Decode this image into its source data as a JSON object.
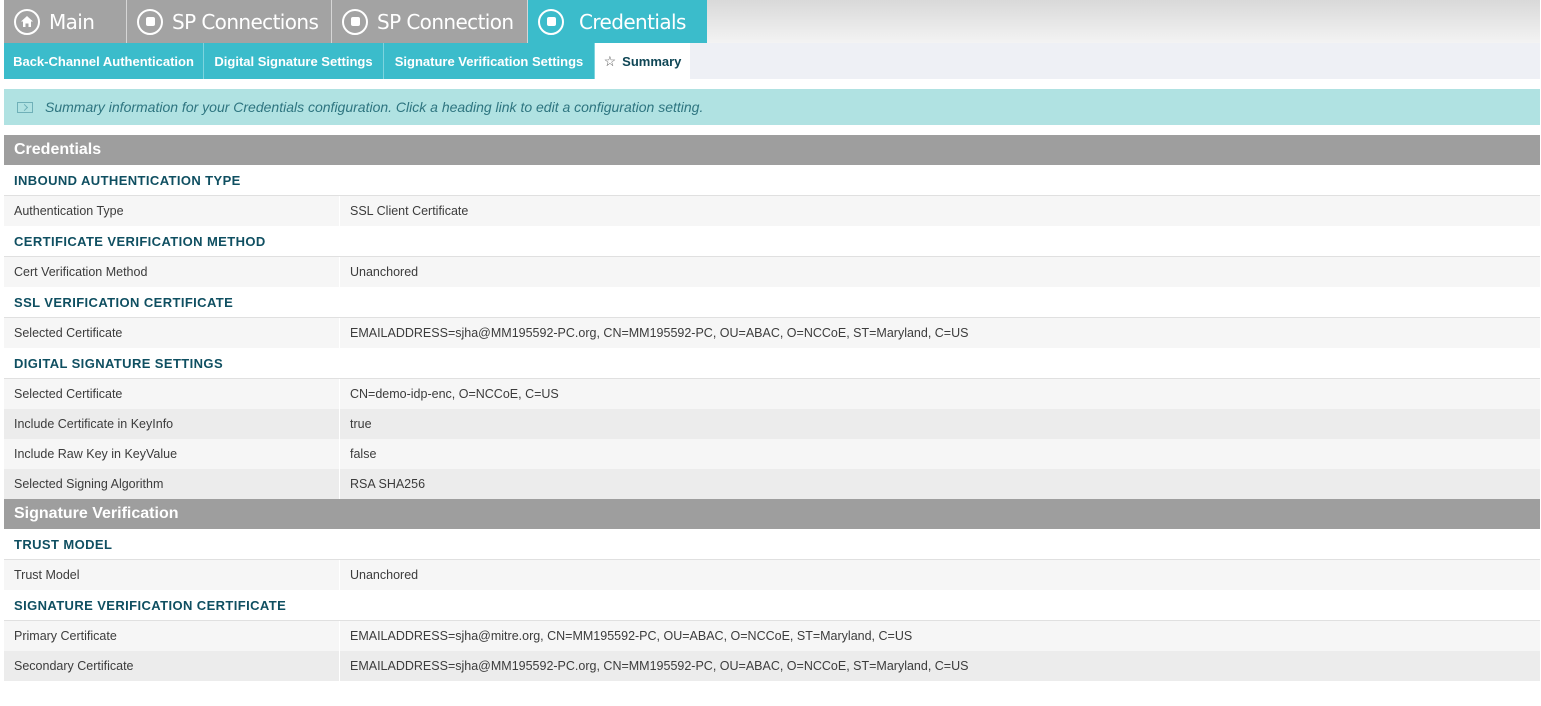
{
  "nav": {
    "top_tabs": [
      {
        "label": "Main",
        "icon": "home-icon"
      },
      {
        "label": "SP Connections",
        "icon": "square-circle-icon"
      },
      {
        "label": "SP Connection",
        "icon": "square-circle-icon"
      },
      {
        "label": "Credentials",
        "icon": "square-circle-icon"
      }
    ],
    "sub_tabs": [
      {
        "label": "Back-Channel Authentication"
      },
      {
        "label": "Digital Signature Settings"
      },
      {
        "label": "Signature Verification Settings"
      },
      {
        "label": "Summary",
        "icon": "star-icon"
      }
    ]
  },
  "info": {
    "text": "Summary information for your Credentials configuration. Click a heading link to edit a configuration setting."
  },
  "sections": [
    {
      "title": "Credentials",
      "groups": [
        {
          "title": "INBOUND AUTHENTICATION TYPE",
          "rows": [
            {
              "label": "Authentication Type",
              "value": "SSL Client Certificate"
            }
          ]
        },
        {
          "title": "CERTIFICATE VERIFICATION METHOD",
          "rows": [
            {
              "label": "Cert Verification Method",
              "value": "Unanchored"
            }
          ]
        },
        {
          "title": "SSL VERIFICATION CERTIFICATE",
          "rows": [
            {
              "label": "Selected Certificate",
              "value": "EMAILADDRESS=sjha@MM195592-PC.org, CN=MM195592-PC, OU=ABAC, O=NCCoE, ST=Maryland, C=US"
            }
          ]
        },
        {
          "title": "DIGITAL SIGNATURE SETTINGS",
          "rows": [
            {
              "label": "Selected Certificate",
              "value": "CN=demo-idp-enc, O=NCCoE, C=US"
            },
            {
              "label": "Include Certificate in KeyInfo",
              "value": "true"
            },
            {
              "label": "Include Raw Key in KeyValue",
              "value": "false"
            },
            {
              "label": "Selected Signing Algorithm",
              "value": "RSA SHA256"
            }
          ]
        }
      ]
    },
    {
      "title": "Signature Verification",
      "groups": [
        {
          "title": "TRUST MODEL",
          "rows": [
            {
              "label": "Trust Model",
              "value": "Unanchored"
            }
          ]
        },
        {
          "title": "SIGNATURE VERIFICATION CERTIFICATE",
          "rows": [
            {
              "label": "Primary Certificate",
              "value": "EMAILADDRESS=sjha@mitre.org, CN=MM195592-PC, OU=ABAC, O=NCCoE, ST=Maryland, C=US"
            },
            {
              "label": "Secondary Certificate",
              "value": "EMAILADDRESS=sjha@MM195592-PC.org, CN=MM195592-PC, OU=ABAC, O=NCCoE, ST=Maryland, C=US"
            }
          ]
        }
      ]
    }
  ]
}
